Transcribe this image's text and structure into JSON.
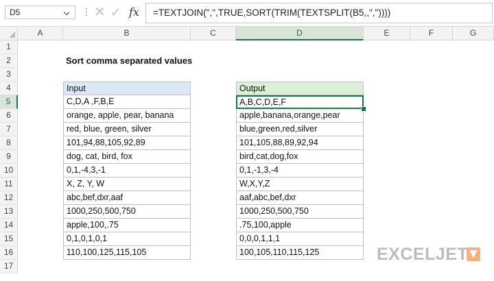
{
  "formula_bar": {
    "name_box": "D5",
    "formula": "=TEXTJOIN(\",\",TRUE,SORT(TRIM(TEXTSPLIT(B5,,\",\"))))",
    "cancel_icon": "x-icon",
    "enter_icon": "check-icon",
    "fx_icon": "fx-icon"
  },
  "columns": [
    "A",
    "B",
    "C",
    "D",
    "E",
    "F",
    "G"
  ],
  "rows": [
    "1",
    "2",
    "3",
    "4",
    "5",
    "6",
    "7",
    "8",
    "9",
    "10",
    "11",
    "12",
    "13",
    "14",
    "15",
    "16",
    "17"
  ],
  "active_cell": {
    "column": "D",
    "row": "5"
  },
  "sheet": {
    "title": "Sort comma separated values",
    "input_header": "Input",
    "output_header": "Output",
    "inputs": [
      "C,D,A ,F,B,E",
      "orange, apple, pear, banana",
      "red, blue, green, silver",
      "101,94,88,105,92,89",
      "dog, cat, bird, fox",
      "0,1,-4,3,-1",
      "X, Z, Y, W",
      "abc,bef,dxr,aaf",
      "1000,250,500,750",
      "apple,100,.75",
      "0,1,0,1,0,1",
      "110,100,125,115,105"
    ],
    "outputs": [
      "A,B,C,D,E,F",
      "apple,banana,orange,pear",
      "blue,green,red,silver",
      "101,105,88,89,92,94",
      "bird,cat,dog,fox",
      "0,1,-1,3,-4",
      "W,X,Y,Z",
      "aaf,abc,bef,dxr",
      "1000,250,500,750",
      ".75,100,apple",
      "0,0,0,1,1,1",
      "100,105,110,115,125"
    ]
  },
  "branding": {
    "logo_text": "EXCELJET",
    "logo_icon": "exceljet-arrow-icon",
    "accent_color": "#217346",
    "input_header_color": "#dde8f6",
    "output_header_color": "#dcefd8"
  }
}
